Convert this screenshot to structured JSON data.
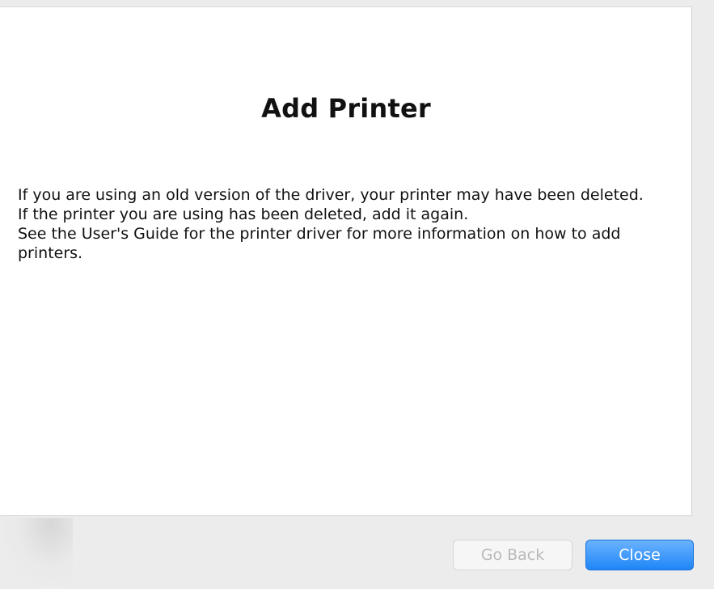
{
  "dialog": {
    "title": "Add Printer",
    "message_lines": [
      "If you are using an old version of the driver, your printer may have been deleted.",
      "If the printer you are using has been deleted, add it again.",
      "See the User's Guide for the printer driver for more information on how to add printers."
    ]
  },
  "buttons": {
    "go_back_label": "Go Back",
    "close_label": "Close"
  },
  "colors": {
    "accent": "#1f86f7",
    "panel_bg": "#ffffff",
    "window_bg": "#ececec",
    "disabled_text": "#b9b9b9"
  }
}
